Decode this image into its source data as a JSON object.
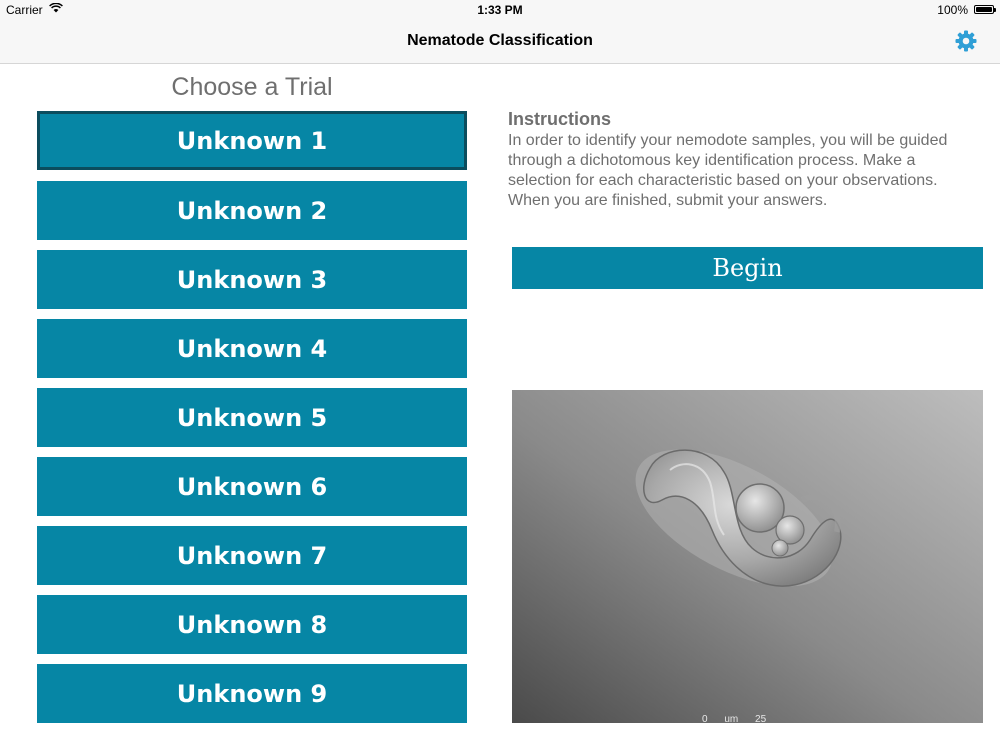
{
  "status_bar": {
    "carrier": "Carrier",
    "time": "1:33 PM",
    "battery": "100%"
  },
  "nav": {
    "title": "Nematode Classification",
    "settings_icon": "gear-icon",
    "accent_color": "#2f9fd6"
  },
  "trials": {
    "title": "Choose a Trial",
    "items": [
      {
        "label": "Unknown 1",
        "selected": true
      },
      {
        "label": "Unknown 2"
      },
      {
        "label": "Unknown 3"
      },
      {
        "label": "Unknown 4"
      },
      {
        "label": "Unknown 5"
      },
      {
        "label": "Unknown 6"
      },
      {
        "label": "Unknown 7"
      },
      {
        "label": "Unknown 8"
      },
      {
        "label": "Unknown 9"
      }
    ],
    "button_color": "#0686a5"
  },
  "instructions": {
    "title": "Instructions",
    "body": "In order to identify your nemodote samples, you will be guided through a dichotomous key identification process. Make a selection for each characteristic based on your observations. When you are finished, submit your answers."
  },
  "begin_button": {
    "label": "Begin"
  },
  "microscope_image": {
    "scale_text": "0 um 25"
  }
}
